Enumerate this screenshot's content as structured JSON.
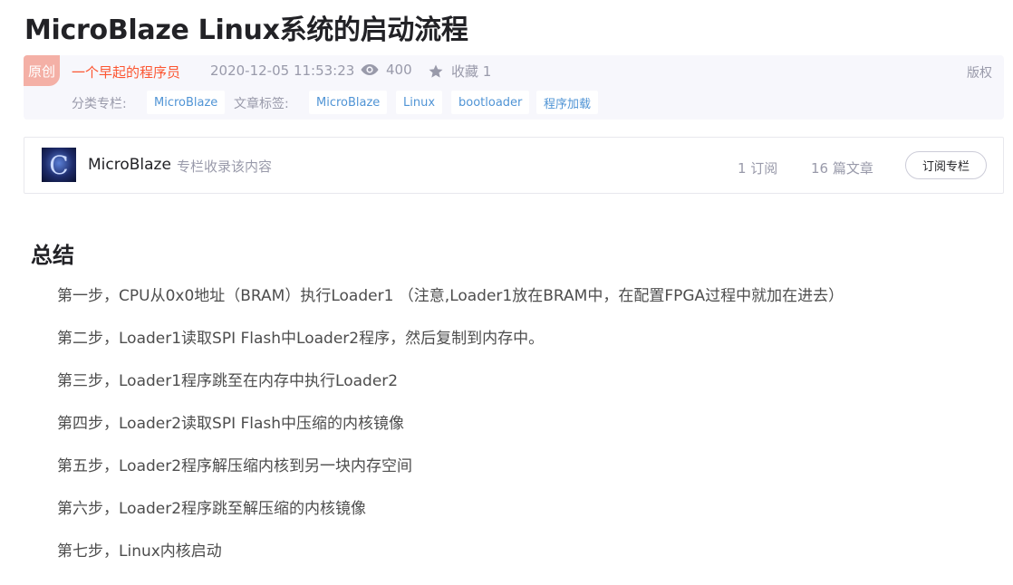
{
  "article": {
    "title": "MicroBlaze Linux系统的启动流程",
    "original_badge": "原创",
    "author": "一个早起的程序员",
    "date": "2020-12-05 11:53:23",
    "views": "400",
    "collect": "收藏 1",
    "copyright": "版权",
    "column_label": "分类专栏:",
    "columns": [
      "MicroBlaze"
    ],
    "tags_label": "文章标签:",
    "tags": [
      "MicroBlaze",
      "Linux",
      "bootloader",
      "程序加载"
    ]
  },
  "column_card": {
    "name": "MicroBlaze",
    "description": "专栏收录该内容",
    "subscribers": "1 订阅",
    "articles": "16 篇文章",
    "subscribe_button": "订阅专栏"
  },
  "content": {
    "heading": "总结",
    "steps": [
      "第一步，CPU从0x0地址（BRAM）执行Loader1 （注意,Loader1放在BRAM中，在配置FPGA过程中就加在进去）",
      "第二步，Loader1读取SPI Flash中Loader2程序，然后复制到内存中。",
      "第三步，Loader1程序跳至在内存中执行Loader2",
      "第四步，Loader2读取SPI Flash中压缩的内核镜像",
      "第五步，Loader2程序解压缩内核到另一块内存空间",
      "第六步，Loader2程序跳至解压缩的内核镜像",
      "第七步，Linux内核启动"
    ]
  },
  "colors": {
    "author": "#fc5531",
    "tag_text": "#5094d5",
    "muted": "#999aaa",
    "badge": "#f4b0a6"
  }
}
